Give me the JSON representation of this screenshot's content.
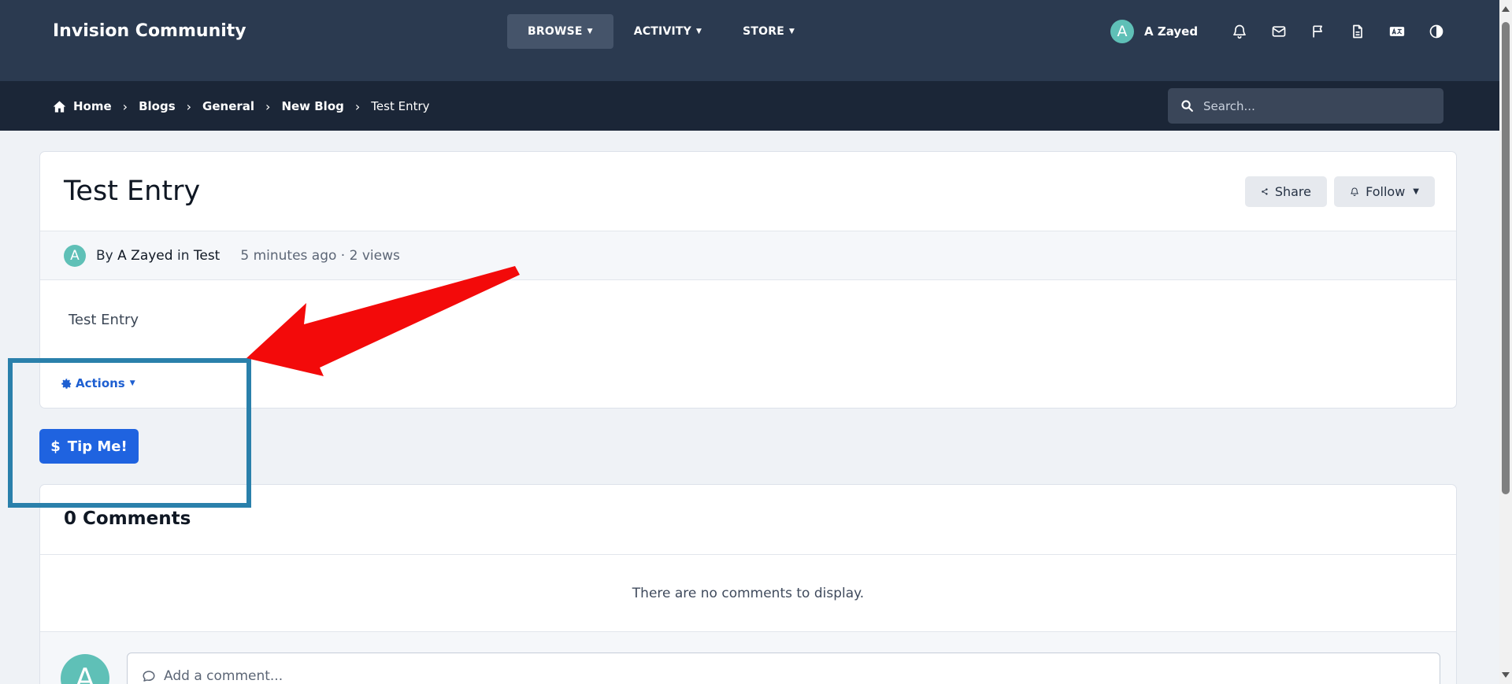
{
  "header": {
    "brand": "Invision Community",
    "nav": [
      {
        "label": "BROWSE"
      },
      {
        "label": "ACTIVITY"
      },
      {
        "label": "STORE"
      }
    ],
    "user": {
      "initial": "A",
      "name": "A Zayed"
    },
    "icons": [
      "bell-icon",
      "envelope-icon",
      "flag-icon",
      "document-icon",
      "language-icon",
      "theme-contrast-icon"
    ]
  },
  "breadcrumb": {
    "items": [
      "Home",
      "Blogs",
      "General",
      "New Blog",
      "Test Entry"
    ],
    "search_placeholder": "Search..."
  },
  "entry": {
    "title": "Test Entry",
    "share_label": "Share",
    "follow_label": "Follow",
    "author_initial": "A",
    "by": "By",
    "author": "A Zayed",
    "in": "in",
    "category": "Test",
    "time_views": "5 minutes ago · 2 views",
    "body": "Test Entry",
    "actions_label": "Actions"
  },
  "tip": {
    "label": "Tip Me!",
    "symbol": "$"
  },
  "comments": {
    "title": "0 Comments",
    "empty_text": "There are no comments to display.",
    "user_initial": "A",
    "input_placeholder": "Add a comment..."
  },
  "colors": {
    "header_bg": "#2b3a50",
    "crumb_bg": "#1b2637",
    "accent": "#1f63e0",
    "avatar": "#5fc0b7",
    "annotation_box": "#2a80ab",
    "annotation_arrow": "#f30a0a"
  }
}
